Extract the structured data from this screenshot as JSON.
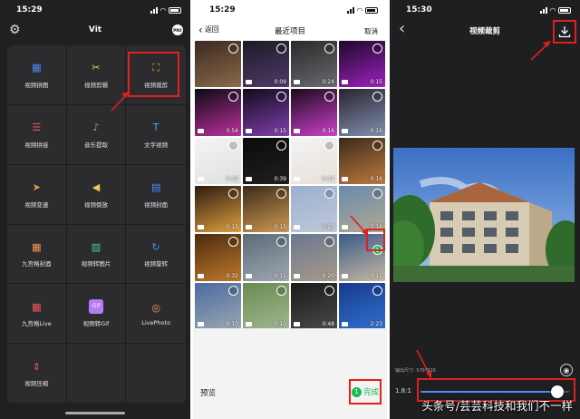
{
  "p1": {
    "time": "15:29",
    "title": "Vit",
    "pro": "PRO",
    "tools": [
      {
        "label": "视频拼图",
        "icon": "grid-layout-icon",
        "color": "#4a8cf7",
        "glyph": "▦"
      },
      {
        "label": "视频剪辑",
        "icon": "scissors-icon",
        "color": "#f2c94c",
        "glyph": "✂"
      },
      {
        "label": "视频裁剪",
        "icon": "crop-icon",
        "color": "#f29b38",
        "glyph": "⛶"
      },
      {
        "label": "视频拼接",
        "icon": "join-icon",
        "color": "#eb5757",
        "glyph": "☰"
      },
      {
        "label": "音乐提取",
        "icon": "music-note-icon",
        "color": "#3ecf8e",
        "glyph": "♪"
      },
      {
        "label": "文字视频",
        "icon": "text-icon",
        "color": "#5aa0f5",
        "glyph": "T"
      },
      {
        "label": "视频变速",
        "icon": "speed-icon",
        "color": "#f2994a",
        "glyph": "➤"
      },
      {
        "label": "视频倒放",
        "icon": "reverse-icon",
        "color": "#f2c94c",
        "glyph": "◀"
      },
      {
        "label": "视频封面",
        "icon": "cover-icon",
        "color": "#4a8cf7",
        "glyph": "▤"
      },
      {
        "label": "九宫格封面",
        "icon": "nine-grid-icon",
        "color": "#f2994a",
        "glyph": "▦"
      },
      {
        "label": "视频转图片",
        "icon": "image-icon",
        "color": "#3ecf8e",
        "glyph": "▨"
      },
      {
        "label": "视频旋转",
        "icon": "rotate-icon",
        "color": "#4a8cf7",
        "glyph": "↻"
      },
      {
        "label": "九宫格Live",
        "icon": "live-grid-icon",
        "color": "#eb5757",
        "glyph": "▦"
      },
      {
        "label": "视频转Gif",
        "icon": "gif-icon",
        "color": "#b97af5",
        "glyph": "Gif"
      },
      {
        "label": "LivePhoto",
        "icon": "livephoto-icon",
        "color": "#f2994a",
        "glyph": "◎"
      },
      {
        "label": "视频压缩",
        "icon": "compress-icon",
        "color": "#eb5757",
        "glyph": "⇕"
      },
      {
        "label": "",
        "icon": "",
        "color": "",
        "glyph": ""
      },
      {
        "label": "",
        "icon": "",
        "color": "",
        "glyph": ""
      }
    ]
  },
  "p2": {
    "time": "15:29",
    "back": "返回",
    "title": "最近项目",
    "cancel": "取消",
    "durations": [
      "",
      "0:09",
      "0:24",
      "0:15",
      "0:54",
      "0:15",
      "0:16",
      "0:16",
      "0:10",
      "0:39",
      "0:15",
      "0:16",
      "0:15",
      "0:15",
      "0:23",
      "3:16",
      "0:32",
      "0:15",
      "0:20",
      "0:15",
      "0:10",
      "0:10",
      "0:48",
      "2:23"
    ],
    "selected_badge": "1",
    "preview": "预览",
    "done_count": "1",
    "done": "完成"
  },
  "p3": {
    "time": "15:30",
    "title": "视频裁剪",
    "size_label": "输出尺寸: 576*320",
    "ratio": "1.8:1",
    "slider_level": 0.92,
    "watermark": "头条号/芸芸科技和我们不一样"
  }
}
